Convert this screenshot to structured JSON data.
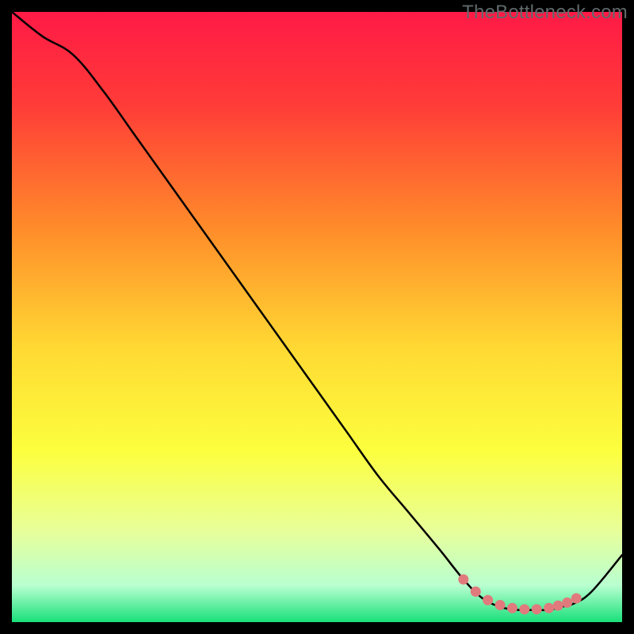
{
  "watermark": "TheBottleneck.com",
  "chart_data": {
    "type": "line",
    "title": "",
    "xlabel": "",
    "ylabel": "",
    "xlim": [
      0,
      100
    ],
    "ylim": [
      0,
      100
    ],
    "x": [
      0,
      5,
      10,
      15,
      20,
      25,
      30,
      35,
      40,
      45,
      50,
      55,
      60,
      65,
      70,
      74,
      77,
      80,
      83,
      86,
      88,
      90,
      92,
      95,
      100
    ],
    "y": [
      100,
      96,
      93,
      87,
      80,
      73,
      66,
      59,
      52,
      45,
      38,
      31,
      24,
      18,
      12,
      7,
      4,
      2.5,
      2,
      2,
      2,
      2.5,
      3,
      5,
      11
    ],
    "marker_points": {
      "x": [
        74,
        76,
        78,
        80,
        82,
        84,
        86,
        88,
        89.5,
        91,
        92.5
      ],
      "y": [
        7,
        5,
        3.6,
        2.8,
        2.3,
        2.1,
        2.1,
        2.3,
        2.7,
        3.2,
        3.9
      ]
    },
    "gradient_stops": [
      {
        "offset": 0.0,
        "color": "#ff1a46"
      },
      {
        "offset": 0.15,
        "color": "#ff3b38"
      },
      {
        "offset": 0.35,
        "color": "#ff8a2a"
      },
      {
        "offset": 0.55,
        "color": "#ffd933"
      },
      {
        "offset": 0.72,
        "color": "#fcff3e"
      },
      {
        "offset": 0.85,
        "color": "#e8ff9a"
      },
      {
        "offset": 0.94,
        "color": "#b8ffd0"
      },
      {
        "offset": 1.0,
        "color": "#18e07a"
      }
    ],
    "curve_color": "#000000",
    "marker_color": "#e07a7d",
    "plot_margin": 15
  }
}
